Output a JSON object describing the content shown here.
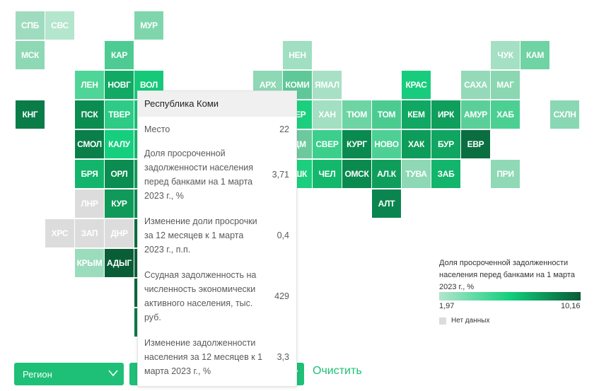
{
  "map": {
    "tiles": [
      {
        "label": "СПБ",
        "color": "#9fdcbf"
      },
      {
        "label": "СВС",
        "color": "#b4e5cd"
      },
      {
        "label": "МУР",
        "color": "#7fd6ad"
      },
      {
        "label": "МСК",
        "color": "#8ed8b5"
      },
      {
        "label": "КАР",
        "color": "#4ecb92"
      },
      {
        "label": "НЕН",
        "color": "#a0dfc1"
      },
      {
        "label": "ЧУК",
        "color": "#a5e0c4"
      },
      {
        "label": "КАМ",
        "color": "#6fd3a4"
      },
      {
        "label": "ЛЕН",
        "color": "#4fd597"
      },
      {
        "label": "НОВГ",
        "color": "#12a964"
      },
      {
        "label": "ВОЛ",
        "color": "#15c979"
      },
      {
        "label": "АРХ",
        "color": "#8fd8b5"
      },
      {
        "label": "КОМИ",
        "color": "#5fc898"
      },
      {
        "label": "ЯМАЛ",
        "color": "#a7e0c5"
      },
      {
        "label": "КРАС",
        "color": "#18cc7d"
      },
      {
        "label": "САХА",
        "color": "#94dab9"
      },
      {
        "label": "МАГ",
        "color": "#8ad7b2"
      },
      {
        "label": "КНГ",
        "color": "#0a7c48"
      },
      {
        "label": "ПСК",
        "color": "#0b8c50"
      },
      {
        "label": "ТВЕР",
        "color": "#2dcb85"
      },
      {
        "label": "ПЕР",
        "color": "#1ccf7f"
      },
      {
        "label": "ХАН",
        "color": "#a3dfc2"
      },
      {
        "label": "ТЮМ",
        "color": "#6dd4a4"
      },
      {
        "label": "ТОМ",
        "color": "#4ccb91"
      },
      {
        "label": "КЕМ",
        "color": "#10a862"
      },
      {
        "label": "ИРК",
        "color": "#0f9e5c"
      },
      {
        "label": "АМУР",
        "color": "#5bcf99"
      },
      {
        "label": "ХАБ",
        "color": "#4ccf93"
      },
      {
        "label": "СХЛН",
        "color": "#8ad7b3"
      },
      {
        "label": "СМОЛ",
        "color": "#0a7f49"
      },
      {
        "label": "КАЛУ",
        "color": "#16cf7e"
      },
      {
        "label": "УДМ",
        "color": "#6cc99e"
      },
      {
        "label": "СВЕР",
        "color": "#3ccf8c"
      },
      {
        "label": "КУРГ",
        "color": "#0b8a4f"
      },
      {
        "label": "НОВО",
        "color": "#4ed095"
      },
      {
        "label": "ХАК",
        "color": "#0e9c5a"
      },
      {
        "label": "БУР",
        "color": "#10a561"
      },
      {
        "label": "ЕВР",
        "color": "#0a6e41"
      },
      {
        "label": "БРЯ",
        "color": "#12b56b"
      },
      {
        "label": "ОРЛ",
        "color": "#0b8c50"
      },
      {
        "label": "БШК",
        "color": "#1ccf7f"
      },
      {
        "label": "ЧЕЛ",
        "color": "#14b86d"
      },
      {
        "label": "ОМСК",
        "color": "#0b8a4f"
      },
      {
        "label": "АЛ.К",
        "color": "#0f9d5b"
      },
      {
        "label": "ТУВА",
        "color": "#8fd8b5"
      },
      {
        "label": "ЗАБ",
        "color": "#12b56b"
      },
      {
        "label": "ПРИ",
        "color": "#90d9b6"
      },
      {
        "label": "ЛНР",
        "color": "#dcdcdc"
      },
      {
        "label": "КУР",
        "color": "#0f9a59"
      },
      {
        "label": "АЛТ",
        "color": "#0b8550"
      },
      {
        "label": "ХРС",
        "color": "#dcdcdc"
      },
      {
        "label": "ЗАП",
        "color": "#dcdcdc"
      },
      {
        "label": "ДНР",
        "color": "#dcdcdc"
      },
      {
        "label": "КРЫМ",
        "color": "#9bdcbd"
      },
      {
        "label": "АДЫГ",
        "color": "#0a5e37"
      }
    ]
  },
  "tooltip": {
    "title": "Республика Коми",
    "rows": [
      {
        "label": "Место",
        "value": "22"
      },
      {
        "label": "Доля просроченной задолженности населения перед банками на 1 марта 2023 г., %",
        "value": "3,71"
      },
      {
        "label": "Изменение доли просрочки за 12 месяцев к 1 марта 2023 г., п.п.",
        "value": "0,4"
      },
      {
        "label": "Ссудная задолженность на численность экономически активного населения, тыс. руб.",
        "value": "429"
      },
      {
        "label": "Изменение задолженности населения за 12 месяцев к 1 марта 2023 г., %",
        "value": "3,3"
      }
    ]
  },
  "legend": {
    "title": "Доля просроченной задолженности населения перед банками на 1 марта 2023 г., %",
    "min": "1,97",
    "max": "10,16",
    "gradient": [
      "#b2e6cd",
      "#12cf7c",
      "#0a5a36"
    ],
    "no_data_label": "Нет данных",
    "no_data_color": "#dcdcdc"
  },
  "controls": {
    "region_select": "Регион",
    "clear_label": "Очистить",
    "accent": "#1ec077"
  }
}
